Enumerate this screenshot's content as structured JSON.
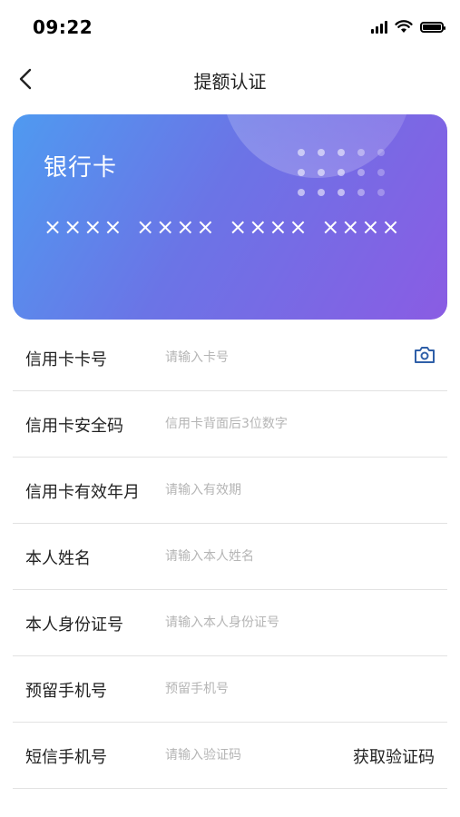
{
  "status_bar": {
    "time": "09:22"
  },
  "nav": {
    "title": "提额认证"
  },
  "card": {
    "title": "银行卡",
    "number": "×××× ×××× ×××× ××××"
  },
  "form": {
    "rows": [
      {
        "label": "信用卡卡号",
        "placeholder": "请输入卡号"
      },
      {
        "label": "信用卡安全码",
        "placeholder": "信用卡背面后3位数字"
      },
      {
        "label": "信用卡有效年月",
        "placeholder": "请输入有效期"
      },
      {
        "label": "本人姓名",
        "placeholder": "请输入本人姓名"
      },
      {
        "label": "本人身份证号",
        "placeholder": "请输入本人身份证号"
      },
      {
        "label": "预留手机号",
        "placeholder": "预留手机号"
      },
      {
        "label": "短信手机号",
        "placeholder": "请输入验证码"
      }
    ],
    "sms_button": "获取验证码"
  },
  "colors": {
    "card_start": "#4f9af0",
    "card_end": "#8a5ce3",
    "camera_icon": "#2f5fa8"
  }
}
